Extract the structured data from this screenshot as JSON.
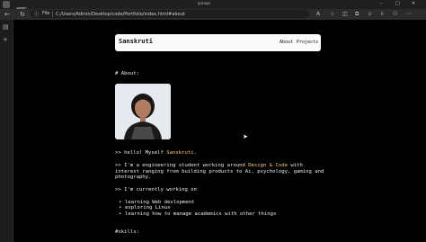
{
  "window": {
    "title": "ipriaaa"
  },
  "addressbar": {
    "file_label": "File",
    "url": "C:/Users/Admin/Desktop/code/Portfolio/index.html#about"
  },
  "nav": {
    "brand": "Sanskruti",
    "links": [
      "About",
      "Projects"
    ]
  },
  "about": {
    "heading": "# About:",
    "hello_prefix": ">> hello! Myself ",
    "hello_name": "Sanskruti.",
    "intro_prefix": ">> I'm a engineering student working around ",
    "intro_highlight": "Design & Code",
    "intro_suffix": " with",
    "intro_line2": "interest ranging from building products to Ai, psychology, gaming and",
    "intro_line3": "photography.",
    "working_on": ">> I'm currently working on",
    "items": [
      "learning Web devlopment",
      "exploring Linux",
      "learning how to manage academics with other things"
    ],
    "skills_heading": "#skills:"
  }
}
